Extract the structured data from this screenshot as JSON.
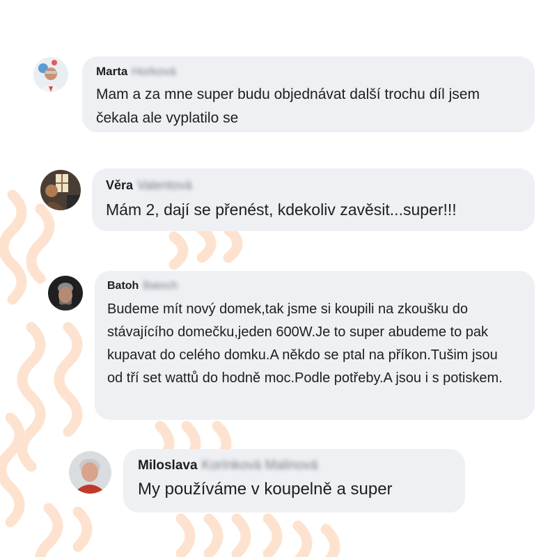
{
  "theme": {
    "bubble_bg": "#eef0f3",
    "text_color": "#1c1e21",
    "decor_color": "#fde3cf"
  },
  "comments": [
    {
      "first_name": "Marta",
      "surname": "Horková",
      "text": "Mam a za mne super budu objednávat další trochu díl jsem čekala ale vyplatilo se",
      "avatar_icon": "user-avatar-photo"
    },
    {
      "first_name": "Věra",
      "surname": "Valentová",
      "text": "Mám 2, dají se přenést, kdekoliv zavěsit...super!!!",
      "avatar_icon": "user-avatar-photo"
    },
    {
      "first_name": "Batoh",
      "surname": "Batoch",
      "text": "Budeme mít nový domek,tak jsme si koupili na zkoušku do stávajícího domečku,jeden 600W.Je to super abudeme to pak kupavat do celého domku.A někdo se ptal na příkon.Tušim jsou od tří set wattů do hodně moc.Podle potřeby.A jsou i s potiskem.",
      "avatar_icon": "user-avatar-photo"
    },
    {
      "first_name": "Miloslava",
      "surname": "Korínková Malinová",
      "text": "My používáme v koupelně a super",
      "avatar_icon": "user-avatar-photo"
    }
  ]
}
